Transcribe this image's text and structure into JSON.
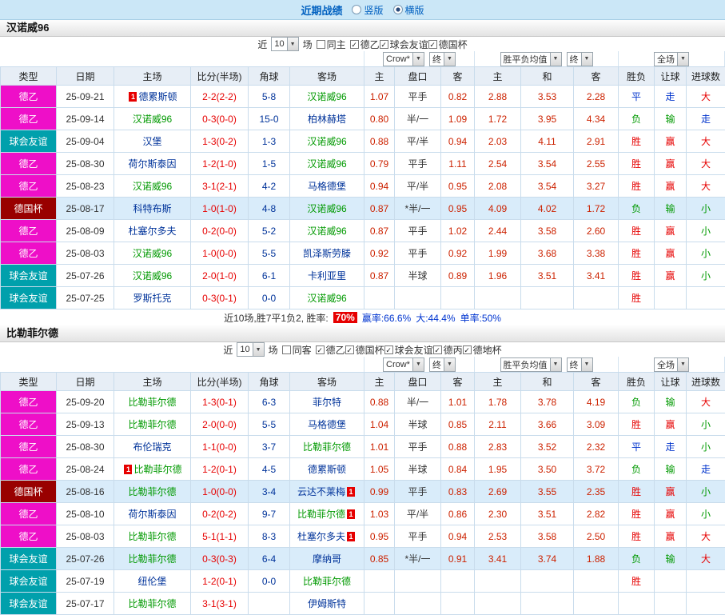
{
  "top_bar": {
    "title": "近期战绩",
    "vertical_label": "竖版",
    "horizontal_label": "横版",
    "selected": "横版"
  },
  "colors": {
    "type_bg": {
      "德乙": "#ee0fc8",
      "球会友谊": "#00a0ac",
      "德国杯": "#990000"
    },
    "focus_team": "#009900",
    "opponent": "#00339a",
    "score": "#e60000",
    "corner": "#00339a",
    "odds": "#cc2200",
    "handicap_text": "#333333",
    "result": {
      "胜": "#e60000",
      "平": "#0033cc",
      "负": "#009900",
      "赢": "#e60000",
      "走": "#0033cc",
      "输": "#009900",
      "大": "#e60000",
      "小": "#009900"
    }
  },
  "sections": [
    {
      "team": "汉诺威96",
      "controls": {
        "near_label": "近",
        "count": "10",
        "games_label": "场",
        "same_label": "同主",
        "leagues": [
          "德乙",
          "球会友谊",
          "德国杯"
        ],
        "bookmaker": "Crow*",
        "final1": "终",
        "avg": "胜平负均值",
        "final2": "终",
        "scope": "全场"
      },
      "header": [
        "类型",
        "日期",
        "主场",
        "比分(半场)",
        "角球",
        "客场",
        "主",
        "盘口",
        "客",
        "主",
        "和",
        "客",
        "胜负",
        "让球",
        "进球数"
      ],
      "rows": [
        {
          "type": "德乙",
          "date": "25-09-21",
          "home": {
            "name": "德累斯顿",
            "badge_before": "1"
          },
          "score": "2-2(2-2)",
          "corner": "5-8",
          "away": {
            "name": "汉诺威96",
            "focus": true
          },
          "odds": [
            "1.07",
            "平手",
            "0.82",
            "2.88",
            "3.53",
            "2.28"
          ],
          "results": [
            "平",
            "走",
            "大"
          ],
          "hl": false
        },
        {
          "type": "德乙",
          "date": "25-09-14",
          "home": {
            "name": "汉诺威96",
            "focus": true
          },
          "score": "0-3(0-0)",
          "corner": "15-0",
          "away": {
            "name": "柏林赫塔"
          },
          "odds": [
            "0.80",
            "半/一",
            "1.09",
            "1.72",
            "3.95",
            "4.34"
          ],
          "results": [
            "负",
            "输",
            "走"
          ],
          "hl": false
        },
        {
          "type": "球会友谊",
          "date": "25-09-04",
          "home": {
            "name": "汉堡"
          },
          "score": "1-3(0-2)",
          "corner": "1-3",
          "away": {
            "name": "汉诺威96",
            "focus": true
          },
          "odds": [
            "0.88",
            "平/半",
            "0.94",
            "2.03",
            "4.11",
            "2.91"
          ],
          "results": [
            "胜",
            "赢",
            "大"
          ],
          "hl": false
        },
        {
          "type": "德乙",
          "date": "25-08-30",
          "home": {
            "name": "荷尔斯泰因"
          },
          "score": "1-2(1-0)",
          "corner": "1-5",
          "away": {
            "name": "汉诺威96",
            "focus": true
          },
          "odds": [
            "0.79",
            "平手",
            "1.11",
            "2.54",
            "3.54",
            "2.55"
          ],
          "results": [
            "胜",
            "赢",
            "大"
          ],
          "hl": false
        },
        {
          "type": "德乙",
          "date": "25-08-23",
          "home": {
            "name": "汉诺威96",
            "focus": true
          },
          "score": "3-1(2-1)",
          "corner": "4-2",
          "away": {
            "name": "马格德堡"
          },
          "odds": [
            "0.94",
            "平/半",
            "0.95",
            "2.08",
            "3.54",
            "3.27"
          ],
          "results": [
            "胜",
            "赢",
            "大"
          ],
          "hl": false
        },
        {
          "type": "德国杯",
          "date": "25-08-17",
          "home": {
            "name": "科特布斯"
          },
          "score": "1-0(1-0)",
          "corner": "4-8",
          "away": {
            "name": "汉诺威96",
            "focus": true
          },
          "odds": [
            "0.87",
            "*半/一",
            "0.95",
            "4.09",
            "4.02",
            "1.72"
          ],
          "results": [
            "负",
            "输",
            "小"
          ],
          "hl": true
        },
        {
          "type": "德乙",
          "date": "25-08-09",
          "home": {
            "name": "杜塞尔多夫"
          },
          "score": "0-2(0-0)",
          "corner": "5-2",
          "away": {
            "name": "汉诺威96",
            "focus": true
          },
          "odds": [
            "0.87",
            "平手",
            "1.02",
            "2.44",
            "3.58",
            "2.60"
          ],
          "results": [
            "胜",
            "赢",
            "小"
          ],
          "hl": false
        },
        {
          "type": "德乙",
          "date": "25-08-03",
          "home": {
            "name": "汉诺威96",
            "focus": true
          },
          "score": "1-0(0-0)",
          "corner": "5-5",
          "away": {
            "name": "凯泽斯劳滕"
          },
          "odds": [
            "0.92",
            "平手",
            "0.92",
            "1.99",
            "3.68",
            "3.38"
          ],
          "results": [
            "胜",
            "赢",
            "小"
          ],
          "hl": false
        },
        {
          "type": "球会友谊",
          "date": "25-07-26",
          "home": {
            "name": "汉诺威96",
            "focus": true
          },
          "score": "2-0(1-0)",
          "corner": "6-1",
          "away": {
            "name": "卡利亚里"
          },
          "odds": [
            "0.87",
            "半球",
            "0.89",
            "1.96",
            "3.51",
            "3.41"
          ],
          "results": [
            "胜",
            "赢",
            "小"
          ],
          "hl": false
        },
        {
          "type": "球会友谊",
          "date": "25-07-25",
          "home": {
            "name": "罗斯托克"
          },
          "score": "0-3(0-1)",
          "corner": "0-0",
          "away": {
            "name": "汉诺威96",
            "focus": true
          },
          "odds": [
            "",
            "",
            "",
            "",
            "",
            ""
          ],
          "results": [
            "胜",
            "",
            ""
          ],
          "hl": false
        }
      ],
      "summary": {
        "prefix": "近10场,胜7平1负2, 胜率:",
        "win_rate": "70%",
        "profit": "赢率:66.6%",
        "big": "大:44.4%",
        "single": "单率:50%"
      }
    },
    {
      "team": "比勒菲尔德",
      "controls": {
        "near_label": "近",
        "count": "10",
        "games_label": "场",
        "same_label": "同客",
        "leagues": [
          "德乙",
          "德国杯",
          "球会友谊",
          "德丙",
          "德地杯"
        ],
        "bookmaker": "Crow*",
        "final1": "终",
        "avg": "胜平负均值",
        "final2": "终",
        "scope": "全场"
      },
      "header": [
        "类型",
        "日期",
        "主场",
        "比分(半场)",
        "角球",
        "客场",
        "主",
        "盘口",
        "客",
        "主",
        "和",
        "客",
        "胜负",
        "让球",
        "进球数"
      ],
      "rows": [
        {
          "type": "德乙",
          "date": "25-09-20",
          "home": {
            "name": "比勒菲尔德",
            "focus": true
          },
          "score": "1-3(0-1)",
          "corner": "6-3",
          "away": {
            "name": "菲尔特"
          },
          "odds": [
            "0.88",
            "半/一",
            "1.01",
            "1.78",
            "3.78",
            "4.19"
          ],
          "results": [
            "负",
            "输",
            "大"
          ],
          "hl": false
        },
        {
          "type": "德乙",
          "date": "25-09-13",
          "home": {
            "name": "比勒菲尔德",
            "focus": true
          },
          "score": "2-0(0-0)",
          "corner": "5-5",
          "away": {
            "name": "马格德堡"
          },
          "odds": [
            "1.04",
            "半球",
            "0.85",
            "2.11",
            "3.66",
            "3.09"
          ],
          "results": [
            "胜",
            "赢",
            "小"
          ],
          "hl": false
        },
        {
          "type": "德乙",
          "date": "25-08-30",
          "home": {
            "name": "布伦瑞克"
          },
          "score": "1-1(0-0)",
          "corner": "3-7",
          "away": {
            "name": "比勒菲尔德",
            "focus": true
          },
          "odds": [
            "1.01",
            "平手",
            "0.88",
            "2.83",
            "3.52",
            "2.32"
          ],
          "results": [
            "平",
            "走",
            "小"
          ],
          "hl": false
        },
        {
          "type": "德乙",
          "date": "25-08-24",
          "home": {
            "name": "比勒菲尔德",
            "focus": true,
            "badge_before": "1"
          },
          "score": "1-2(0-1)",
          "corner": "4-5",
          "away": {
            "name": "德累斯顿"
          },
          "odds": [
            "1.05",
            "半球",
            "0.84",
            "1.95",
            "3.50",
            "3.72"
          ],
          "results": [
            "负",
            "输",
            "走"
          ],
          "hl": false
        },
        {
          "type": "德国杯",
          "date": "25-08-16",
          "home": {
            "name": "比勒菲尔德",
            "focus": true
          },
          "score": "1-0(0-0)",
          "corner": "3-4",
          "away": {
            "name": "云达不莱梅",
            "badge_after": "1"
          },
          "odds": [
            "0.99",
            "平手",
            "0.83",
            "2.69",
            "3.55",
            "2.35"
          ],
          "results": [
            "胜",
            "赢",
            "小"
          ],
          "hl": true
        },
        {
          "type": "德乙",
          "date": "25-08-10",
          "home": {
            "name": "荷尔斯泰因"
          },
          "score": "0-2(0-2)",
          "corner": "9-7",
          "away": {
            "name": "比勒菲尔德",
            "focus": true,
            "badge_after": "1"
          },
          "odds": [
            "1.03",
            "平/半",
            "0.86",
            "2.30",
            "3.51",
            "2.82"
          ],
          "results": [
            "胜",
            "赢",
            "小"
          ],
          "hl": false
        },
        {
          "type": "德乙",
          "date": "25-08-03",
          "home": {
            "name": "比勒菲尔德",
            "focus": true
          },
          "score": "5-1(1-1)",
          "corner": "8-3",
          "away": {
            "name": "杜塞尔多夫",
            "badge_after": "1"
          },
          "odds": [
            "0.95",
            "平手",
            "0.94",
            "2.53",
            "3.58",
            "2.50"
          ],
          "results": [
            "胜",
            "赢",
            "大"
          ],
          "hl": false
        },
        {
          "type": "球会友谊",
          "date": "25-07-26",
          "home": {
            "name": "比勒菲尔德",
            "focus": true
          },
          "score": "0-3(0-3)",
          "corner": "6-4",
          "away": {
            "name": "摩纳哥"
          },
          "odds": [
            "0.85",
            "*半/一",
            "0.91",
            "3.41",
            "3.74",
            "1.88"
          ],
          "results": [
            "负",
            "输",
            "大"
          ],
          "hl": true
        },
        {
          "type": "球会友谊",
          "date": "25-07-19",
          "home": {
            "name": "纽伦堡"
          },
          "score": "1-2(0-1)",
          "corner": "0-0",
          "away": {
            "name": "比勒菲尔德",
            "focus": true
          },
          "odds": [
            "",
            "",
            "",
            "",
            "",
            ""
          ],
          "results": [
            "胜",
            "",
            ""
          ],
          "hl": false
        },
        {
          "type": "球会友谊",
          "date": "25-07-17",
          "home": {
            "name": "比勒菲尔德",
            "focus": true
          },
          "score": "3-1(3-1)",
          "corner": "",
          "away": {
            "name": "伊姆斯特"
          },
          "odds": [
            "",
            "",
            "",
            "",
            "",
            ""
          ],
          "results": [
            "",
            "",
            ""
          ],
          "hl": false
        }
      ]
    }
  ]
}
